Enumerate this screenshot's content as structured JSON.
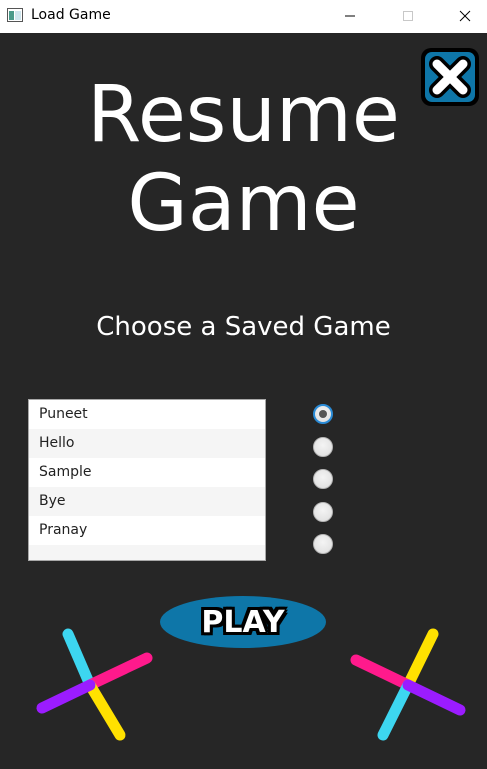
{
  "window": {
    "title": "Load Game",
    "minimize_glyph": "—",
    "maximize_glyph": "☐",
    "close_glyph": "✕"
  },
  "header": {
    "title_line1": "Resume",
    "title_line2": "Game",
    "subtitle": "Choose a Saved Game"
  },
  "saved_games": {
    "items": [
      {
        "label": "Puneet"
      },
      {
        "label": "Hello"
      },
      {
        "label": "Sample"
      },
      {
        "label": "Bye"
      },
      {
        "label": "Pranay"
      }
    ],
    "selected_index": 0
  },
  "play_button": {
    "label": "PLAY"
  },
  "icons": {
    "close": "close-x-icon",
    "app": "app-window-icon",
    "decoration": "pinwheel-icon"
  },
  "colors": {
    "background": "#262626",
    "play_ellipse": "#0e76a8",
    "close_badge": "#0e76a8",
    "radio_selected_ring": "#2a8bd6",
    "pinwheel_cyan": "#3dd6f0",
    "pinwheel_magenta": "#ff1a8c",
    "pinwheel_yellow": "#ffe100",
    "pinwheel_purple": "#9b1cff"
  }
}
